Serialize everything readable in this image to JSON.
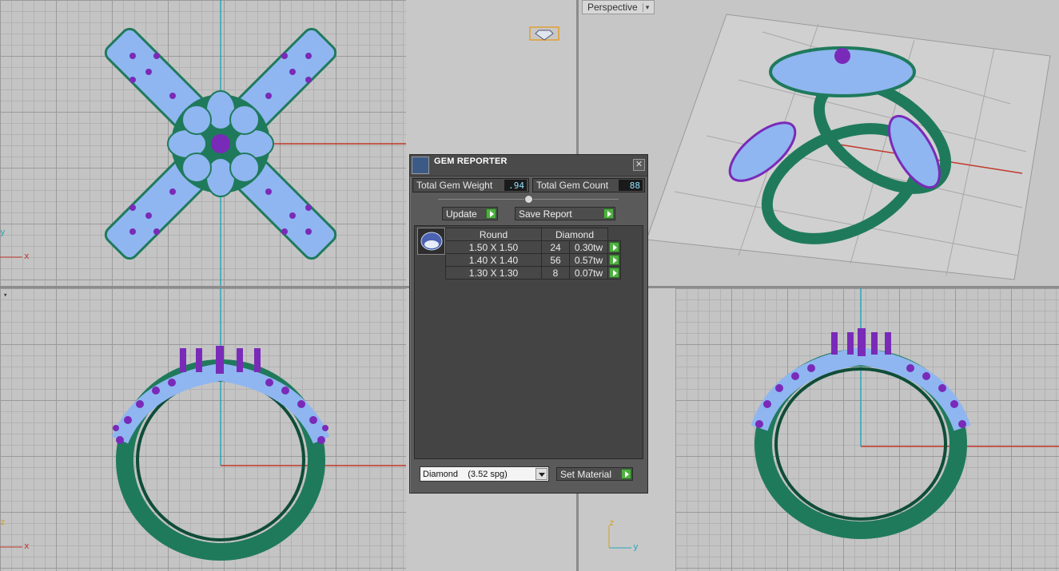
{
  "viewports": {
    "top_left": {
      "axes": {
        "x": "x",
        "y": "y"
      }
    },
    "top_right": {
      "label": "Perspective",
      "menu_glyph": "▾"
    },
    "bottom_left": {
      "axes": {
        "x": "x",
        "z": "z"
      },
      "menu_glyph": "▾"
    },
    "bottom_right": {
      "axes": {
        "y": "y",
        "z": "z"
      }
    }
  },
  "colors": {
    "ring_metal": "#1f7a5c",
    "ring_metal_dark": "#0f4d38",
    "gem_fill": "#8fb6f0",
    "prong": "#7a2ab8",
    "axis_red": "#c0392b",
    "axis_cyan": "#2aa6b8",
    "dialog_bg": "#5a5a5a",
    "go_green": "#4fb041"
  },
  "gem_reporter": {
    "title": "GEM REPORTER",
    "close_glyph": "✕",
    "total_gem_weight_label": "Total Gem Weight",
    "total_gem_weight_value": ".94",
    "total_gem_count_label": "Total Gem Count",
    "total_gem_count_value": "88",
    "update_button": "Update",
    "save_report_button": "Save Report",
    "table": {
      "shape_header": "Round",
      "material_header": "Diamond",
      "rows": [
        {
          "size": "1.50 X 1.50",
          "count": "24",
          "weight": "0.30tw"
        },
        {
          "size": "1.40 X 1.40",
          "count": "56",
          "weight": "0.57tw"
        },
        {
          "size": "1.30 X 1.30",
          "count": "8",
          "weight": "0.07tw"
        }
      ]
    },
    "material_select": {
      "value": "Diamond    (3.52 spg)"
    },
    "set_material_button": "Set Material"
  }
}
